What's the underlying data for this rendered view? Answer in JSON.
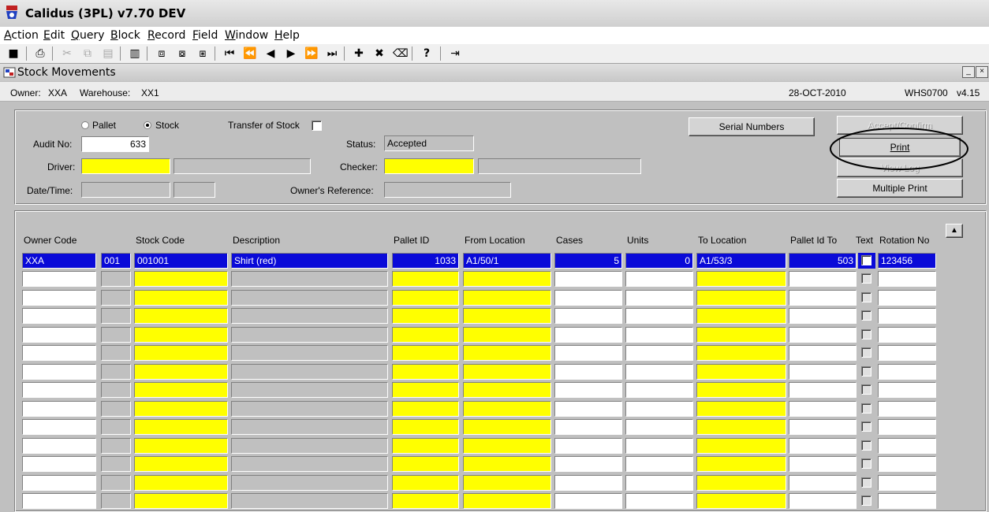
{
  "app": {
    "title": "Calidus (3PL) v7.70 DEV"
  },
  "menu": [
    {
      "label": "Action",
      "u": "A",
      "rest": "ction"
    },
    {
      "label": "Edit",
      "u": "E",
      "rest": "dit"
    },
    {
      "label": "Query",
      "u": "Q",
      "rest": "uery"
    },
    {
      "label": "Block",
      "u": "B",
      "rest": "lock"
    },
    {
      "label": "Record",
      "u": "R",
      "rest": "ecord"
    },
    {
      "label": "Field",
      "u": "F",
      "rest": "ield"
    },
    {
      "label": "Window",
      "u": "W",
      "rest": "indow"
    },
    {
      "label": "Help",
      "u": "H",
      "rest": "elp"
    }
  ],
  "window": {
    "title": "Stock Movements",
    "minimize": "_",
    "close": "×"
  },
  "info": {
    "owner_label": "Owner:",
    "owner": "XXA",
    "warehouse_label": "Warehouse:",
    "warehouse": "XX1",
    "date": "28-OCT-2010",
    "screen": "WHS0700",
    "version": "v4.15"
  },
  "header": {
    "pallet_label": "Pallet",
    "stock_label": "Stock",
    "selected_mode": "Stock",
    "transfer_label": "Transfer of Stock",
    "audit_label": "Audit No:",
    "audit_no": "633",
    "status_label": "Status:",
    "status": "Accepted",
    "driver_label": "Driver:",
    "checker_label": "Checker:",
    "datetime_label": "Date/Time:",
    "owners_ref_label": "Owner's Reference:"
  },
  "buttons": {
    "serial_numbers": "Serial Numbers",
    "accept_confirm": "Accept/Confirm",
    "print": "Print",
    "view_log": "View Log",
    "multiple_print": "Multiple Print"
  },
  "table": {
    "columns": [
      "Owner Code",
      "Stock Code",
      "Description",
      "Pallet ID",
      "From Location",
      "Cases",
      "Units",
      "To Location",
      "Pallet Id To",
      "Text",
      "Rotation No"
    ],
    "rows": [
      {
        "owner_code": "XXA",
        "line": "001",
        "stock_code": "001001",
        "description": "Shirt (red)",
        "pallet_id": "1033",
        "from_location": "A1/50/1",
        "cases": "5",
        "units": "0",
        "to_location": "A1/53/3",
        "pallet_id_to": "503",
        "rotation_no": "123456"
      }
    ],
    "empty_rows": 13
  }
}
